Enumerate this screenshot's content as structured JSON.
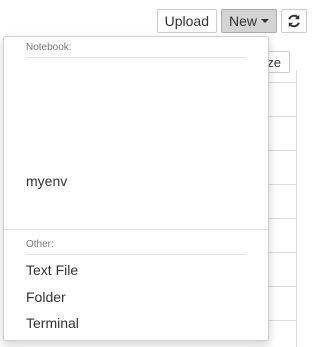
{
  "toolbar": {
    "upload_label": "Upload",
    "new_label": "New",
    "refresh_icon": "refresh-icon"
  },
  "background": {
    "partial_button_text": "ze"
  },
  "new_menu": {
    "notebook_header": "Notebook:",
    "kernels": [
      "myenv"
    ],
    "other_header": "Other:",
    "other_items": [
      "Text File",
      "Folder",
      "Terminal"
    ]
  }
}
